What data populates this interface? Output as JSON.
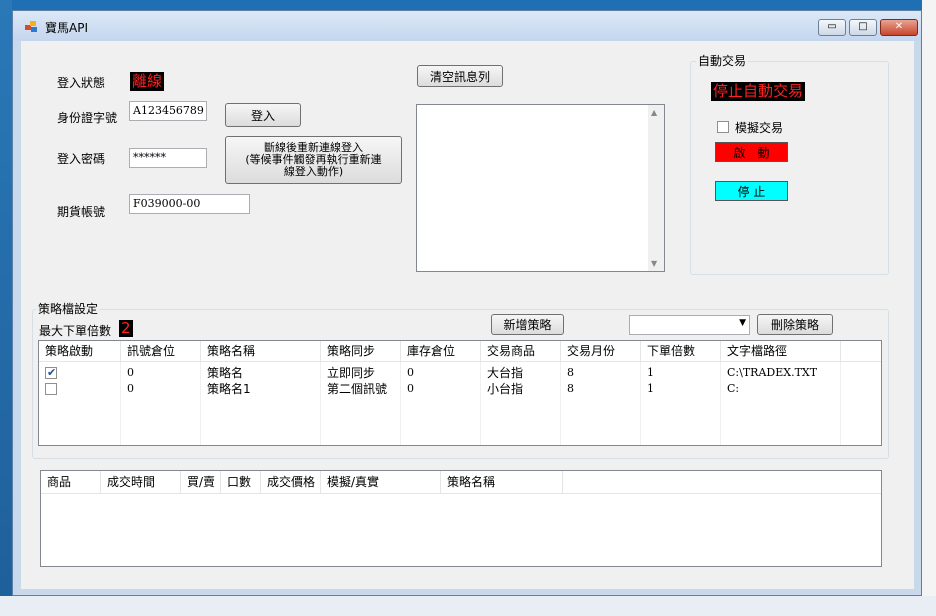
{
  "window": {
    "title": "寶馬API",
    "minimize": "▭",
    "maximize": "□",
    "close": "✕"
  },
  "login": {
    "status_label": "登入狀態",
    "status_value": "離線",
    "id_label": "身份證字號",
    "id_value": "A123456789",
    "password_label": "登入密碼",
    "password_value": "******",
    "account_label": "期貨帳號",
    "account_value": "F039000-00",
    "login_button": "登入",
    "reconnect_line1": "斷線後重新連線登入",
    "reconnect_line2": "(等候事件觸發再執行重新連",
    "reconnect_line3": "線登入動作)",
    "clear_messages_button": "清空訊息列"
  },
  "auto_trade": {
    "group_title": "自動交易",
    "status_banner": "停止自動交易",
    "simulate_label": "模擬交易",
    "start_button": "啟　動",
    "stop_button": "停 止"
  },
  "strategy": {
    "group_title": "策略檔設定",
    "max_multiplier_label": "最大下單倍數",
    "max_multiplier_value": "2",
    "add_button": "新增策略",
    "delete_button": "刪除策略",
    "combo_value": "",
    "columns": [
      "策略啟動",
      "訊號倉位",
      "策略名稱",
      "策略同步",
      "庫存倉位",
      "交易商品",
      "交易月份",
      "下單倍數",
      "文字檔路徑"
    ],
    "rows": [
      {
        "enabled": true,
        "signal_pos": "0",
        "name": "策略名",
        "sync": "立即同步",
        "inventory": "0",
        "product": "大台指",
        "month": "8",
        "multiplier": "1",
        "path": "C:\\TRADEX.TXT"
      },
      {
        "enabled": false,
        "signal_pos": "0",
        "name": "策略名1",
        "sync": "第二個訊號",
        "inventory": "0",
        "product": "小台指",
        "month": "8",
        "multiplier": "1",
        "path": "C:"
      }
    ]
  },
  "trades": {
    "columns": [
      "商品",
      "成交時間",
      "買/賣",
      "口數",
      "成交價格",
      "模擬/真實",
      "策略名稱"
    ]
  },
  "colors": {
    "start": "#ff0000",
    "stop": "#00ffff",
    "banner_bg": "#000000",
    "banner_fg": "#ff2020"
  }
}
